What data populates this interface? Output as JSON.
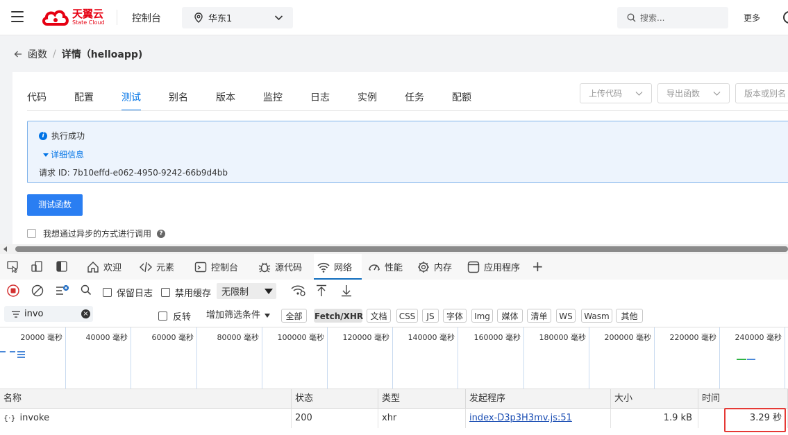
{
  "topnav": {
    "logo_cn": "天翼云",
    "logo_en": "State Cloud",
    "console": "控制台",
    "region": "华东1",
    "search_placeholder": "搜索...",
    "more": "更多"
  },
  "breadcrumb": {
    "parent": "函数",
    "current": "详情（helloapp)"
  },
  "function_tabs": [
    "代码",
    "配置",
    "测试",
    "别名",
    "版本",
    "监控",
    "日志",
    "实例",
    "任务",
    "配额"
  ],
  "active_tab": "测试",
  "actions": {
    "upload_code": "上传代码",
    "export_function": "导出函数",
    "version_alias": "版本或别名"
  },
  "result": {
    "status": "执行成功",
    "details": "详细信息",
    "request_id": "请求 ID: 7b10effd-e062-4950-9242-66b9d4bb"
  },
  "test_button": "测试函数",
  "async_label": "我想通过异步的方式进行调用",
  "devtools": {
    "tabs": [
      {
        "label": "欢迎",
        "icon": "home-icon"
      },
      {
        "label": "元素",
        "icon": "code-icon"
      },
      {
        "label": "控制台",
        "icon": "console-icon"
      },
      {
        "label": "源代码",
        "icon": "bug-icon"
      },
      {
        "label": "网络",
        "icon": "wifi-icon"
      },
      {
        "label": "性能",
        "icon": "gauge-icon"
      },
      {
        "label": "内存",
        "icon": "chip-icon"
      },
      {
        "label": "应用程序",
        "icon": "app-icon"
      }
    ],
    "active_tab": "网络",
    "toolbar": {
      "preserve_log": "保留日志",
      "disable_cache": "禁用缓存",
      "throttling": "无限制"
    },
    "filter": {
      "value": "invo",
      "invert": "反转",
      "add_filter": "增加筛选条件",
      "types": [
        "全部",
        "Fetch/XHR",
        "文档",
        "CSS",
        "JS",
        "字体",
        "Img",
        "媒体",
        "清单",
        "WS",
        "Wasm",
        "其他"
      ],
      "active_type": "Fetch/XHR"
    },
    "timeline": {
      "ticks": [
        "20000 毫秒",
        "40000 毫秒",
        "60000 毫秒",
        "80000 毫秒",
        "100000 毫秒",
        "120000 毫秒",
        "140000 毫秒",
        "160000 毫秒",
        "180000 毫秒",
        "200000 毫秒",
        "220000 毫秒",
        "240000 毫秒"
      ]
    },
    "table": {
      "columns": [
        "名称",
        "状态",
        "类型",
        "发起程序",
        "大小",
        "时间"
      ],
      "rows": [
        {
          "name": "invoke",
          "status": "200",
          "type": "xhr",
          "initiator": "index-D3p3H3mv.js:51",
          "size": "1.9 kB",
          "time": "3.29 秒"
        }
      ]
    }
  },
  "colors": {
    "brand_red": "#e60012",
    "primary_blue": "#0073e6",
    "button_blue": "#2a7ef2",
    "highlight_red": "#e53935"
  }
}
